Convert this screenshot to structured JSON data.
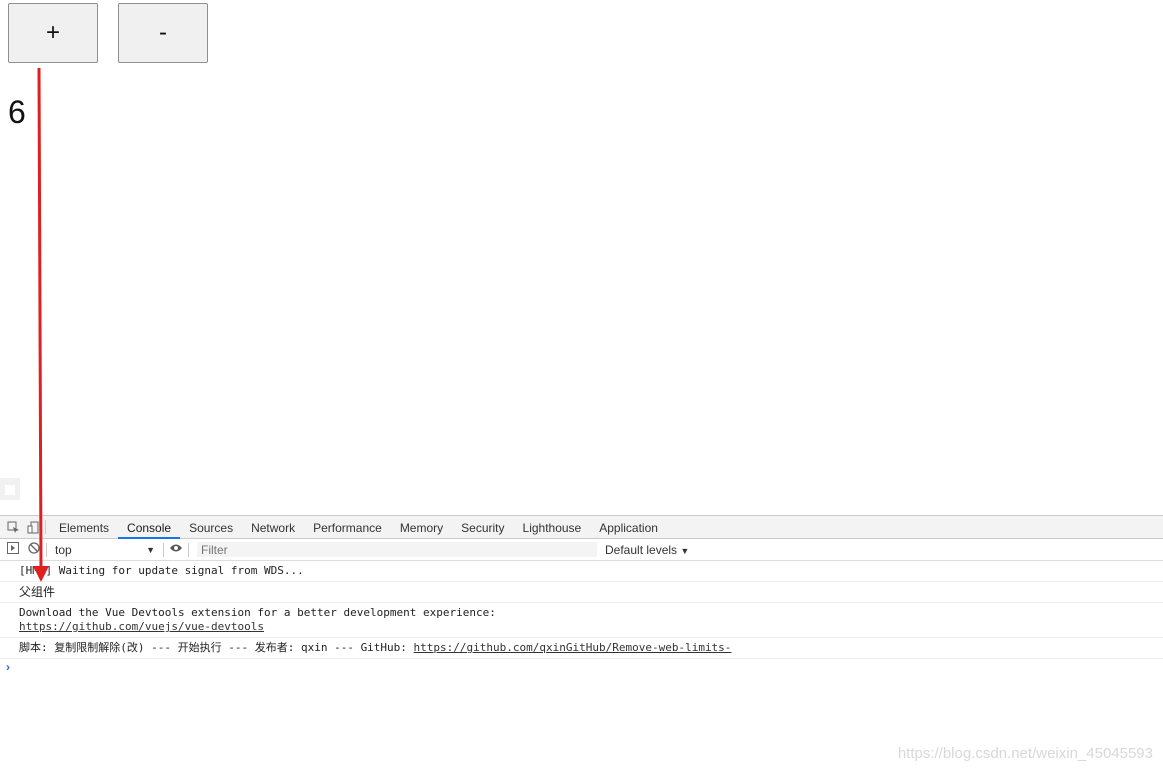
{
  "app": {
    "plus_label": "+",
    "minus_label": "-",
    "count": "6"
  },
  "devtools": {
    "tabs": [
      "Elements",
      "Console",
      "Sources",
      "Network",
      "Performance",
      "Memory",
      "Security",
      "Lighthouse",
      "Application"
    ],
    "active_tab": "Console",
    "context": "top",
    "filter_placeholder": "Filter",
    "levels": "Default levels",
    "messages": {
      "m1": "[HMR] Waiting for update signal from WDS...",
      "m2": "父组件",
      "m3_line1": "Download the Vue Devtools extension for a better development experience:",
      "m3_link": "https://github.com/vuejs/vue-devtools",
      "m4_text": "脚本: 复制限制解除(改) --- 开始执行 --- 发布者: qxin --- GitHub: ",
      "m4_link": "https://github.com/qxinGitHub/Remove-web-limits-"
    },
    "prompt": "›"
  },
  "watermark": "https://blog.csdn.net/weixin_45045593",
  "annotation_color": "#e02020"
}
